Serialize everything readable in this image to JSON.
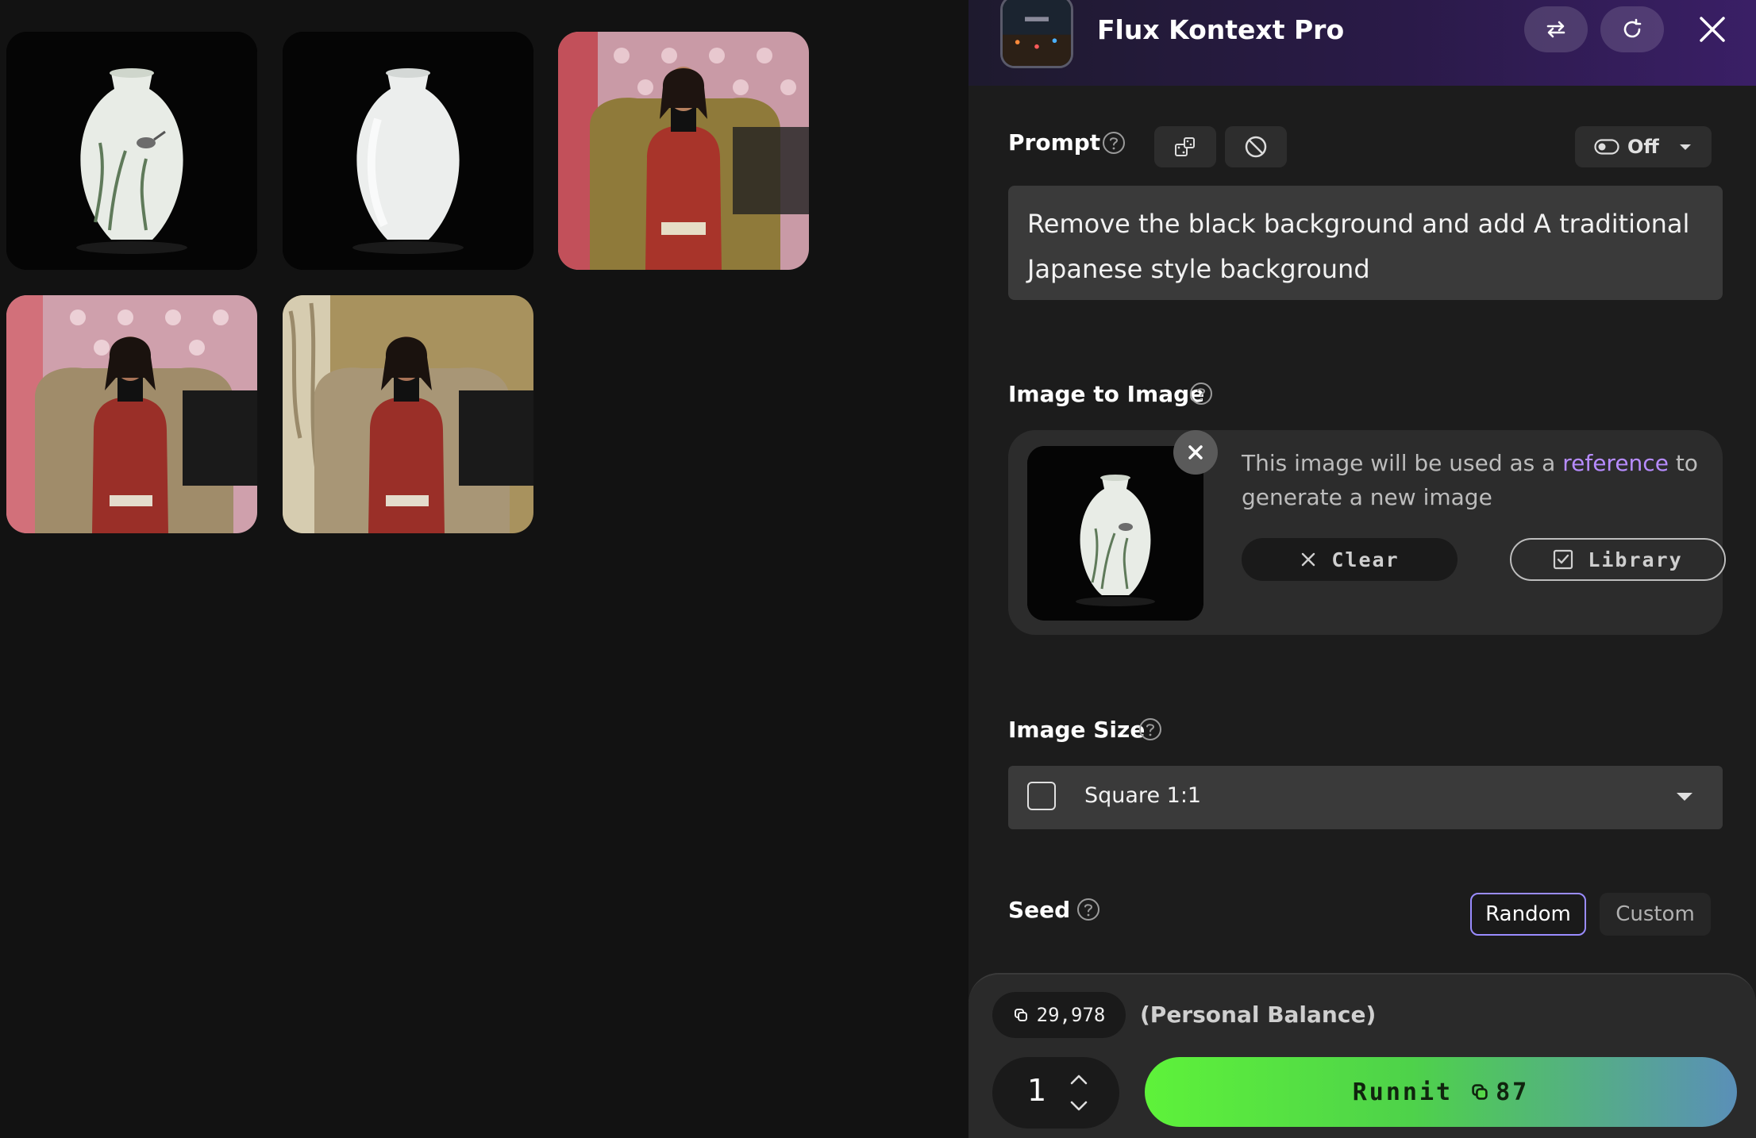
{
  "app": {
    "title": "Flux Kontext Pro"
  },
  "prompt": {
    "label": "Prompt",
    "toggle_label": "Off",
    "text": "Remove the black background and add A traditional Japanese style background"
  },
  "image_to_image": {
    "label": "Image to Image",
    "description_before": "This image will be used as a ",
    "description_link": "reference",
    "description_after": " to generate a new image",
    "clear_label": "Clear",
    "library_label": "Library"
  },
  "image_size": {
    "label": "Image Size",
    "selected": "Square 1:1"
  },
  "seed": {
    "label": "Seed",
    "random_label": "Random",
    "custom_label": "Custom"
  },
  "footer": {
    "balance": "29,978",
    "balance_label": "(Personal Balance)",
    "quantity": "1",
    "run_label": "Runnit",
    "run_cost": "87"
  },
  "colors": {
    "accent_purple": "#b78cff",
    "run_green": "#5ef23a",
    "panel_bg": "#1c1c1c"
  }
}
